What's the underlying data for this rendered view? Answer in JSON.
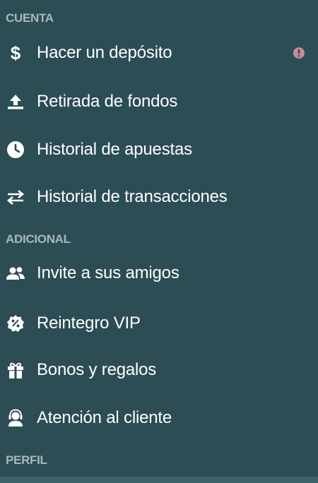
{
  "sections": {
    "cuenta": "CUENTA",
    "adicional": "ADICIONAL",
    "perfil": "PERFIL"
  },
  "items": {
    "deposit": {
      "label": "Hacer un depósito",
      "icon": "dollar-icon"
    },
    "withdraw": {
      "label": "Retirada de fondos",
      "icon": "upload-icon"
    },
    "bet_history": {
      "label": "Historial de apuestas",
      "icon": "clock-icon"
    },
    "transactions": {
      "label": "Historial de transacciones",
      "icon": "swap-arrows-icon"
    },
    "invite": {
      "label": "Invite a sus amigos",
      "icon": "people-icon"
    },
    "vip": {
      "label": "Reintegro VIP",
      "icon": "percent-badge-icon"
    },
    "bonus": {
      "label": "Bonos y regalos",
      "icon": "gift-icon"
    },
    "support": {
      "label": "Atención al cliente",
      "icon": "support-agent-icon"
    }
  },
  "colors": {
    "background": "#2b4d53",
    "section_text": "#a8b9bc",
    "item_text": "#ffffff",
    "alert": "#c98b93"
  }
}
